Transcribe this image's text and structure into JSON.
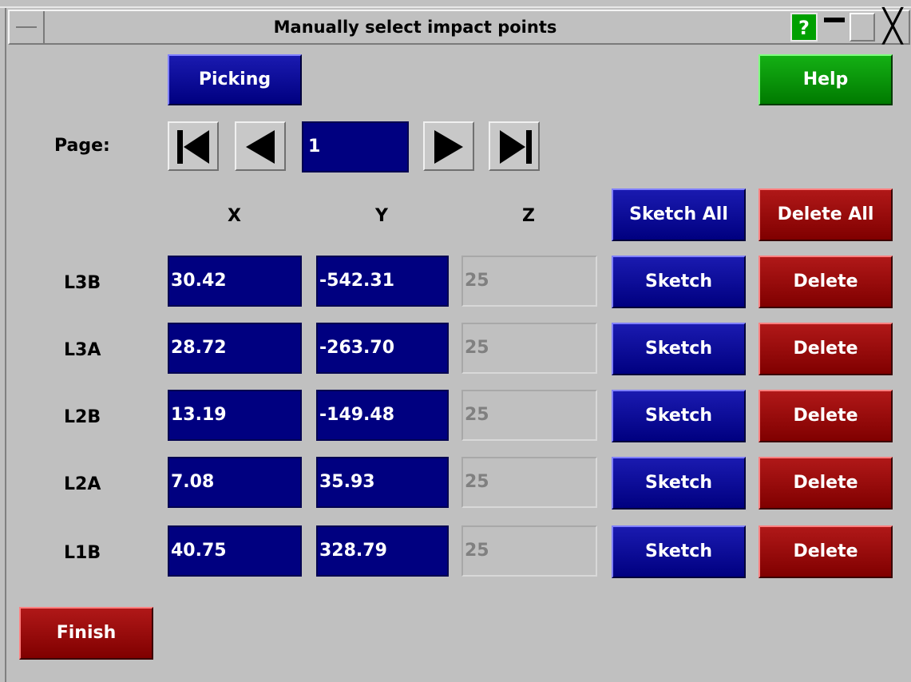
{
  "window": {
    "title": "Manually select impact points",
    "help_glyph": "?",
    "close_glyph": "╳"
  },
  "toolbar": {
    "picking_label": "Picking",
    "help_label": "Help"
  },
  "pager": {
    "label": "Page:",
    "current": "1",
    "first_icon": "first-page-icon",
    "prev_icon": "prev-page-icon",
    "next_icon": "next-page-icon",
    "last_icon": "last-page-icon"
  },
  "columns": {
    "x": "X",
    "y": "Y",
    "z": "Z",
    "sketch_all": "Sketch All",
    "delete_all": "Delete All"
  },
  "rows": [
    {
      "name": "L3B",
      "x": "30.42",
      "y": "-542.31",
      "z": "25",
      "sketch": "Sketch",
      "delete": "Delete"
    },
    {
      "name": "L3A",
      "x": "28.72",
      "y": "-263.70",
      "z": "25",
      "sketch": "Sketch",
      "delete": "Delete"
    },
    {
      "name": "L2B",
      "x": "13.19",
      "y": "-149.48",
      "z": "25",
      "sketch": "Sketch",
      "delete": "Delete"
    },
    {
      "name": "L2A",
      "x": "7.08",
      "y": "35.93",
      "z": "25",
      "sketch": "Sketch",
      "delete": "Delete"
    },
    {
      "name": "L1B",
      "x": "40.75",
      "y": "328.79",
      "z": "25",
      "sketch": "Sketch",
      "delete": "Delete"
    }
  ],
  "footer": {
    "finish_label": "Finish"
  },
  "colors": {
    "panel": "#c0c0c0",
    "edit_field": "#000080",
    "blue_button": "#000080",
    "red_button": "#800000",
    "green_button": "#008000"
  }
}
